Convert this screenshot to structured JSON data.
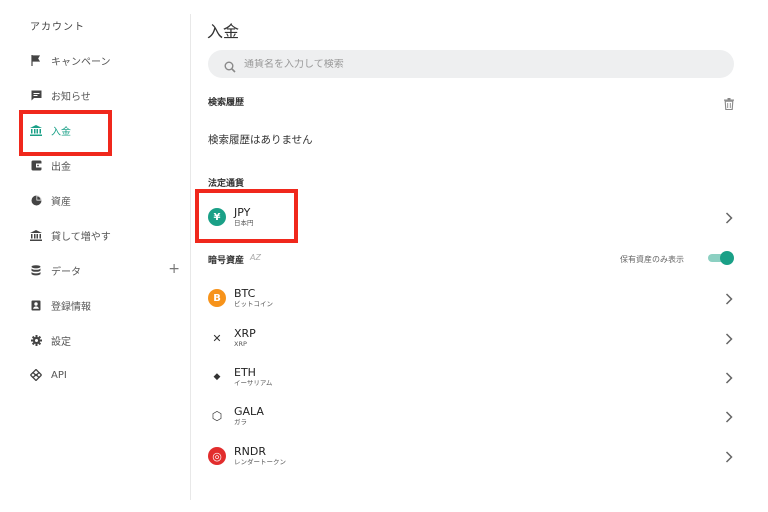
{
  "sidebar": {
    "title": "アカウント",
    "items": [
      {
        "label": "キャンペーン",
        "icon": "flag-icon"
      },
      {
        "label": "お知らせ",
        "icon": "message-icon"
      },
      {
        "label": "入金",
        "icon": "bank-icon"
      },
      {
        "label": "出金",
        "icon": "wallet-icon"
      },
      {
        "label": "資産",
        "icon": "pie-chart-icon"
      },
      {
        "label": "貸して増やす",
        "icon": "bank-icon"
      },
      {
        "label": "データ",
        "icon": "database-icon",
        "expand": "+"
      },
      {
        "label": "登録情報",
        "icon": "id-card-icon"
      },
      {
        "label": "設定",
        "icon": "gear-icon"
      },
      {
        "label": "API",
        "icon": "api-icon"
      }
    ],
    "active_index": 2
  },
  "main": {
    "title": "入金",
    "search": {
      "placeholder": "通貨名を入力して検索",
      "value": ""
    },
    "history": {
      "label": "検索履歴",
      "empty": "検索履歴はありません"
    },
    "fiat": {
      "label": "法定通貨",
      "items": [
        {
          "symbol": "JPY",
          "name": "日本円",
          "icon_text": "¥",
          "color": "#1aa087"
        }
      ]
    },
    "crypto": {
      "label": "暗号資産",
      "sort_icon": "AZ",
      "toggle_label": "保有資産のみ表示",
      "toggle_on": true,
      "items": [
        {
          "symbol": "BTC",
          "name": "ビットコイン",
          "icon_text": "B",
          "color": "#f7931a"
        },
        {
          "symbol": "XRP",
          "name": "XRP",
          "icon_text": "✕",
          "color": "#ffffff"
        },
        {
          "symbol": "ETH",
          "name": "イーサリアム",
          "icon_text": "◆",
          "color": "#ffffff"
        },
        {
          "symbol": "GALA",
          "name": "ガラ",
          "icon_text": "⬡",
          "color": "#ffffff"
        },
        {
          "symbol": "RNDR",
          "name": "レンダートークン",
          "icon_text": "◎",
          "color": "#e22d2d"
        }
      ]
    }
  },
  "colors": {
    "accent": "#1aa087",
    "highlight": "#f0281c"
  }
}
